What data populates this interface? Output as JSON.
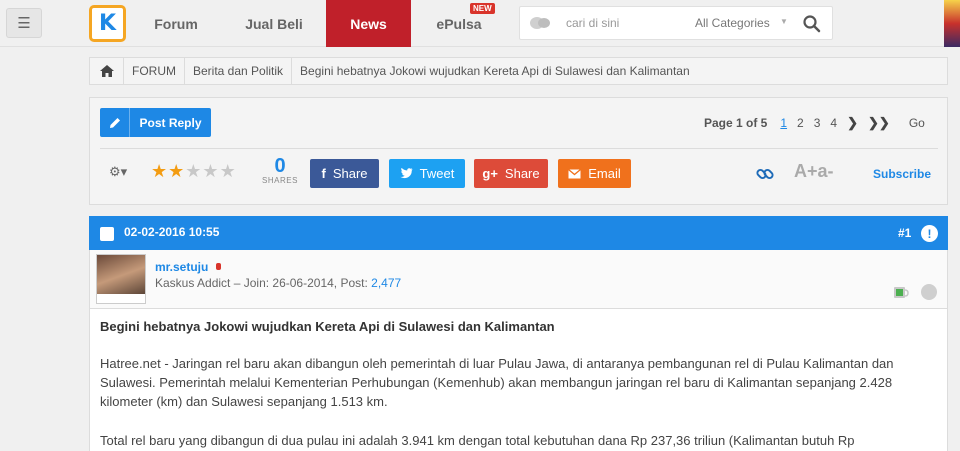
{
  "nav": {
    "logo_text": "K",
    "items": [
      {
        "label": "Forum"
      },
      {
        "label": "Jual Beli"
      },
      {
        "label": "News"
      },
      {
        "label": "ePulsa"
      }
    ],
    "new_badge": "NEW",
    "active_color": "#c0202a"
  },
  "search": {
    "placeholder": "cari di sini",
    "category": "All Categories"
  },
  "breadcrumb": {
    "items": [
      "FORUM",
      "Berita dan Politik",
      "Begini hebatnya Jokowi wujudkan Kereta Api di Sulawesi dan Kalimantan"
    ]
  },
  "toolbar": {
    "post_reply": "Post Reply",
    "page_label": "Page 1 of 5",
    "pages": [
      "1",
      "2",
      "3",
      "4"
    ],
    "go": "Go",
    "rating": 2,
    "rating_max": 5,
    "shares_count": "0",
    "shares_label": "SHARES",
    "facebook_label": "Share",
    "twitter_label": "Tweet",
    "google_label": "Share",
    "email_label": "Email",
    "font_size": "A+a-",
    "subscribe": "Subscribe",
    "accent_color": "#1e88e5"
  },
  "post": {
    "date": "02-02-2016 10:55",
    "number": "#1",
    "username": "mr.setuju",
    "rank": "Kaskus Addict",
    "join_label": "Join: 26-06-2014, Post:",
    "post_count": "2,477",
    "title": "Begini hebatnya Jokowi wujudkan Kereta Api di Sulawesi dan Kalimantan",
    "paragraphs": [
      "Hatree.net - Jaringan rel baru akan dibangun oleh pemerintah di luar Pulau Jawa, di antaranya pembangunan rel di Pulau Kalimantan dan Sulawesi. Pemerintah melalui Kementerian Perhubungan (Kemenhub) akan membangun jaringan rel baru di Kalimantan sepanjang 2.428 kilometer (km) dan Sulawesi sepanjang 1.513 km.",
      "Total rel baru yang dibangun di dua pulau ini adalah 3.941 km dengan total kebutuhan dana Rp 237,36 triliun (Kalimantan butuh Rp"
    ]
  }
}
